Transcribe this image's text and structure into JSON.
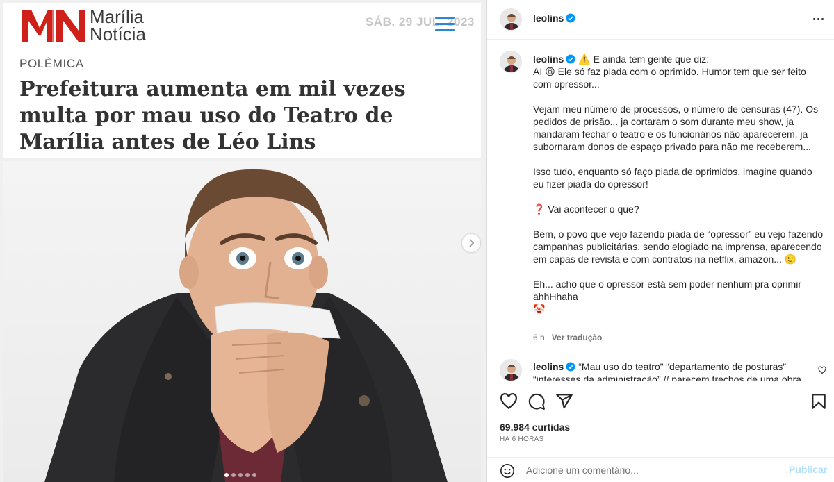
{
  "news_card": {
    "logo_line1": "Marília",
    "logo_line2": "Notícia",
    "date": "SÁB. 29 JUL. 2023",
    "kicker": "POLÊMICA",
    "headline": "Prefeitura aumenta em mil vezes multa por mau uso do Teatro de Marília antes de Léo Lins"
  },
  "carousel": {
    "total": 5,
    "active": 1
  },
  "post": {
    "username": "leolins",
    "caption_username": "leolins",
    "caption_lines": [
      "⚠️ E ainda tem gente que diz:",
      "AI 😩 Ele só faz piada com o oprimido. Humor tem que ser feito com opressor...",
      "",
      "Vejam meu número de processos, o número de censuras (47). Os pedidos de prisão... ja cortaram o som durante meu show, ja mandaram fechar o teatro e os funcionários não aparecerem, ja subornaram donos de espaço privado para não me receberem...",
      "",
      "Isso tudo, enquanto só faço piada de oprimidos, imagine quando eu fizer piada do opressor!",
      "",
      "❓ Vai acontecer o que?",
      "",
      "Bem, o povo que vejo fazendo piada de “opressor” eu vejo fazendo campanhas publicitárias, sendo elogiado na imprensa, aparecendo em capas de revista e com contratos na netflix, amazon... 🙂",
      "",
      "Eh... acho que o opressor está sem poder nenhum pra oprimir ahhHhaha",
      "🤡"
    ],
    "caption_time": "6 h",
    "translate": "Ver tradução",
    "reply_username": "leolins",
    "reply_text": "“Mau uso do teatro” “departamento de posturas” “interesses da administração” // parecem trechos de uma obra",
    "likes": "69.984 curtidas",
    "posted": "HÁ 6 HORAS",
    "comment_placeholder": "Adicione um comentário...",
    "publish": "Publicar"
  },
  "colors": {
    "brand_red": "#d0201a",
    "verified_blue": "#0095f6",
    "menu_blue": "#2b86d9"
  },
  "icons": [
    "more-icon",
    "verified-icon",
    "heart-icon",
    "comment-icon",
    "share-icon",
    "save-icon",
    "emoji-icon",
    "chevron-right-icon",
    "menu-icon"
  ]
}
